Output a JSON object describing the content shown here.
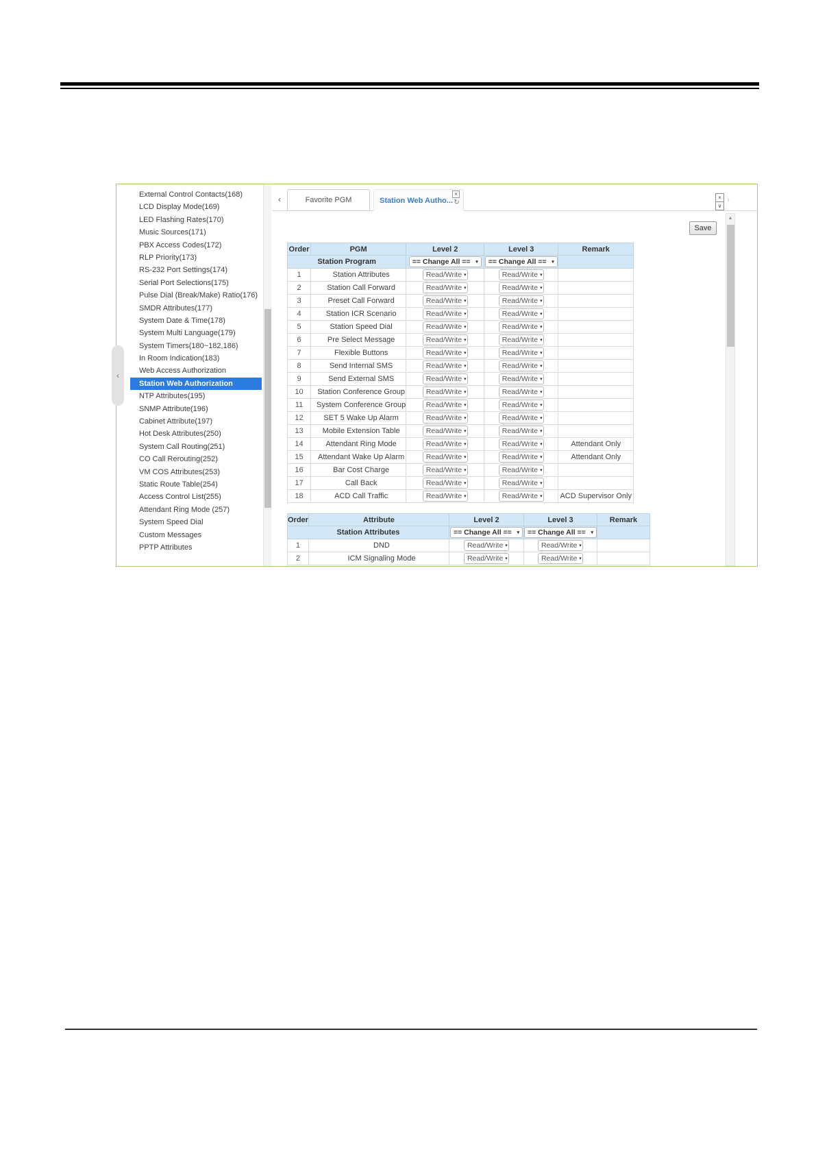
{
  "colors": {
    "accent_green": "#a3c96d",
    "highlight_blue": "#2a7ce0",
    "header_blue": "#d4e7f7",
    "tab_active_blue": "#3e7fc1"
  },
  "sidebar": {
    "collapse_icon": "‹",
    "active_index": 15,
    "items": [
      "External Control Contacts(168)",
      "LCD Display Mode(169)",
      "LED Flashing Rates(170)",
      "Music Sources(171)",
      "PBX Access Codes(172)",
      "RLP Priority(173)",
      "RS-232 Port Settings(174)",
      "Serial Port Selections(175)",
      "Pulse Dial (Break/Make) Ratio(176)",
      "SMDR Attributes(177)",
      "System Date & Time(178)",
      "System Multi Language(179)",
      "System Timers(180~182,186)",
      "In Room Indication(183)",
      "Web Access Authorization",
      "Station Web Authorization",
      "NTP Attributes(195)",
      "SNMP Attribute(196)",
      "Cabinet Attribute(197)",
      "Hot Desk Attributes(250)",
      "System Call Routing(251)",
      "CO Call Rerouting(252)",
      "VM COS Attributes(253)",
      "Static Route Table(254)",
      "Access Control List(255)",
      "Attendant Ring Mode (257)",
      "System Speed Dial",
      "Custom Messages",
      "PPTP Attributes"
    ]
  },
  "tabbar": {
    "left_scroll_icon": "‹",
    "right_scroll_icon": "›",
    "tabs": [
      {
        "label": "Favorite PGM"
      },
      {
        "label": "Station Web Autho...",
        "close_icon": "×",
        "refresh_icon": "↻"
      }
    ],
    "panel_close_icon": "×",
    "panel_collapse_icon": "∨"
  },
  "toolbar": {
    "save_label": "Save"
  },
  "scrollbar": {
    "up_icon": "▲"
  },
  "select_arrow": "▾",
  "tables": [
    {
      "columns": [
        "Order",
        "PGM",
        "Level 2",
        "Level 3",
        "Remark"
      ],
      "group": {
        "label": "Station Program",
        "level2": "== Change All ==",
        "level3": "== Change All =="
      },
      "rows": [
        {
          "order": "1",
          "name": "Station Attributes",
          "level2": "Read/Write",
          "level3": "Read/Write",
          "remark": ""
        },
        {
          "order": "2",
          "name": "Station Call Forward",
          "level2": "Read/Write",
          "level3": "Read/Write",
          "remark": ""
        },
        {
          "order": "3",
          "name": "Preset Call Forward",
          "level2": "Read/Write",
          "level3": "Read/Write",
          "remark": ""
        },
        {
          "order": "4",
          "name": "Station ICR Scenario",
          "level2": "Read/Write",
          "level3": "Read/Write",
          "remark": ""
        },
        {
          "order": "5",
          "name": "Station Speed Dial",
          "level2": "Read/Write",
          "level3": "Read/Write",
          "remark": ""
        },
        {
          "order": "6",
          "name": "Pre Select Message",
          "level2": "Read/Write",
          "level3": "Read/Write",
          "remark": ""
        },
        {
          "order": "7",
          "name": "Flexible Buttons",
          "level2": "Read/Write",
          "level3": "Read/Write",
          "remark": ""
        },
        {
          "order": "8",
          "name": "Send Internal SMS",
          "level2": "Read/Write",
          "level3": "Read/Write",
          "remark": ""
        },
        {
          "order": "9",
          "name": "Send External SMS",
          "level2": "Read/Write",
          "level3": "Read/Write",
          "remark": ""
        },
        {
          "order": "10",
          "name": "Station Conference Group",
          "level2": "Read/Write",
          "level3": "Read/Write",
          "remark": ""
        },
        {
          "order": "11",
          "name": "System Conference Group",
          "level2": "Read/Write",
          "level3": "Read/Write",
          "remark": ""
        },
        {
          "order": "12",
          "name": "SET 5 Wake Up Alarm",
          "level2": "Read/Write",
          "level3": "Read/Write",
          "remark": ""
        },
        {
          "order": "13",
          "name": "Mobile Extension Table",
          "level2": "Read/Write",
          "level3": "Read/Write",
          "remark": ""
        },
        {
          "order": "14",
          "name": "Attendant Ring Mode",
          "level2": "Read/Write",
          "level3": "Read/Write",
          "remark": "Attendant Only"
        },
        {
          "order": "15",
          "name": "Attendant Wake Up Alarm",
          "level2": "Read/Write",
          "level3": "Read/Write",
          "remark": "Attendant Only"
        },
        {
          "order": "16",
          "name": "Bar Cost Charge",
          "level2": "Read/Write",
          "level3": "Read/Write",
          "remark": ""
        },
        {
          "order": "17",
          "name": "Call Back",
          "level2": "Read/Write",
          "level3": "Read/Write",
          "remark": ""
        },
        {
          "order": "18",
          "name": "ACD Call Traffic",
          "level2": "Read/Write",
          "level3": "Read/Write",
          "remark": "ACD Supervisor Only"
        }
      ]
    },
    {
      "columns": [
        "Order",
        "Attribute",
        "Level 2",
        "Level 3",
        "Remark"
      ],
      "group": {
        "label": "Station Attributes",
        "level2": "== Change All ==",
        "level3": "== Change All =="
      },
      "rows": [
        {
          "order": "1",
          "name": "DND",
          "level2": "Read/Write",
          "level3": "Read/Write",
          "remark": ""
        },
        {
          "order": "2",
          "name": "ICM Signaling Mode",
          "level2": "Read/Write",
          "level3": "Read/Write",
          "remark": ""
        }
      ]
    }
  ]
}
